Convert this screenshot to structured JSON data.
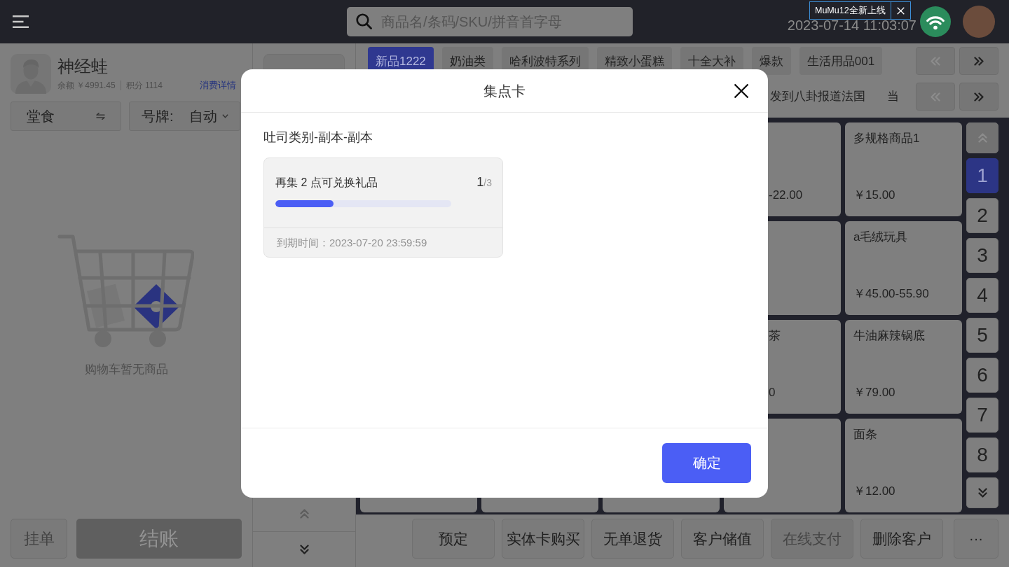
{
  "top_bar": {
    "search": {
      "placeholder": "商品名/条码/SKU/拼音首字母"
    },
    "clock": "2023-07-14 11:03:07",
    "notice": {
      "text": "MuMu12全新上线"
    }
  },
  "customer": {
    "name": "神经蛙",
    "balance": "余额 ￥4991.45",
    "points": "积分 1114",
    "details_link": "消费详情"
  },
  "order_options": [
    {
      "kind": "toggle",
      "label": "堂食"
    },
    {
      "kind": "dropdown",
      "label": "号牌:",
      "value": "自动"
    }
  ],
  "cart": {
    "empty_text": "购物车暂无商品",
    "actions": [
      {
        "kind": "hold",
        "label": "挂单",
        "disabled": true
      },
      {
        "kind": "checkout",
        "label": "结账",
        "disabled": true
      }
    ]
  },
  "side_panel": {
    "scroll_up": {
      "disabled": true
    },
    "scroll_down": {
      "disabled": false
    }
  },
  "category_rows": [
    {
      "kind": "chips",
      "items": [
        {
          "label": "新品1222",
          "selected": true
        },
        {
          "label": "奶油类",
          "selected": false
        },
        {
          "label": "哈利波特系列",
          "selected": false
        },
        {
          "label": "精致小蛋糕",
          "selected": false
        },
        {
          "label": "十全大补",
          "selected": false
        },
        {
          "label": "爆款",
          "selected": false
        },
        {
          "label": "生活用品001",
          "selected": false
        }
      ],
      "prev": {
        "disabled": true
      },
      "next": {
        "disabled": false
      }
    },
    {
      "kind": "text",
      "items": [
        {
          "label": "发到八卦报道法国",
          "selected": false
        },
        {
          "label": "当",
          "selected": false
        }
      ],
      "prev": {
        "disabled": true
      },
      "next": {
        "disabled": false
      }
    }
  ],
  "product_rows": [
    {
      "partial": {
        "price": "-22.00"
      },
      "product": {
        "name": "多规格商品1",
        "price": "￥15.00"
      }
    },
    {
      "product": {
        "name": "a毛绒玩具",
        "price": "￥45.00-55.90"
      }
    },
    {
      "partial": {
        "name": "茶",
        "price": "0"
      },
      "product": {
        "name": "牛油麻辣锅底",
        "price": "￥79.00"
      }
    },
    {
      "product": {
        "name": "面条",
        "price": "￥12.00"
      }
    }
  ],
  "page_nav": {
    "up": {
      "disabled": true
    },
    "pages": [
      {
        "label": "1",
        "selected": true
      },
      {
        "label": "2",
        "selected": false
      },
      {
        "label": "3",
        "selected": false
      },
      {
        "label": "4",
        "selected": false
      },
      {
        "label": "5",
        "selected": false
      },
      {
        "label": "6",
        "selected": false
      },
      {
        "label": "7",
        "selected": false
      },
      {
        "label": "8",
        "selected": false
      }
    ],
    "down": {
      "disabled": false
    }
  },
  "actions": [
    {
      "kind": "text",
      "label": "预定",
      "disabled": false
    },
    {
      "kind": "text",
      "label": "实体卡购买",
      "disabled": false
    },
    {
      "kind": "text",
      "label": "无单退货",
      "disabled": false
    },
    {
      "kind": "text",
      "label": "客户储值",
      "disabled": false
    },
    {
      "kind": "text",
      "label": "在线支付",
      "disabled": true
    },
    {
      "kind": "text",
      "label": "删除客户",
      "disabled": false
    },
    {
      "kind": "more",
      "label": "···",
      "disabled": false
    }
  ],
  "modal": {
    "title": "集点卡",
    "group": "吐司类别-副本-副本",
    "cards": [
      {
        "message": "再集 2 点可兑换礼品",
        "count": "1",
        "total": "/3",
        "level": 0.33,
        "expiry": "到期时间：2023-07-20 23:59:59"
      }
    ],
    "confirm": "确定"
  }
}
